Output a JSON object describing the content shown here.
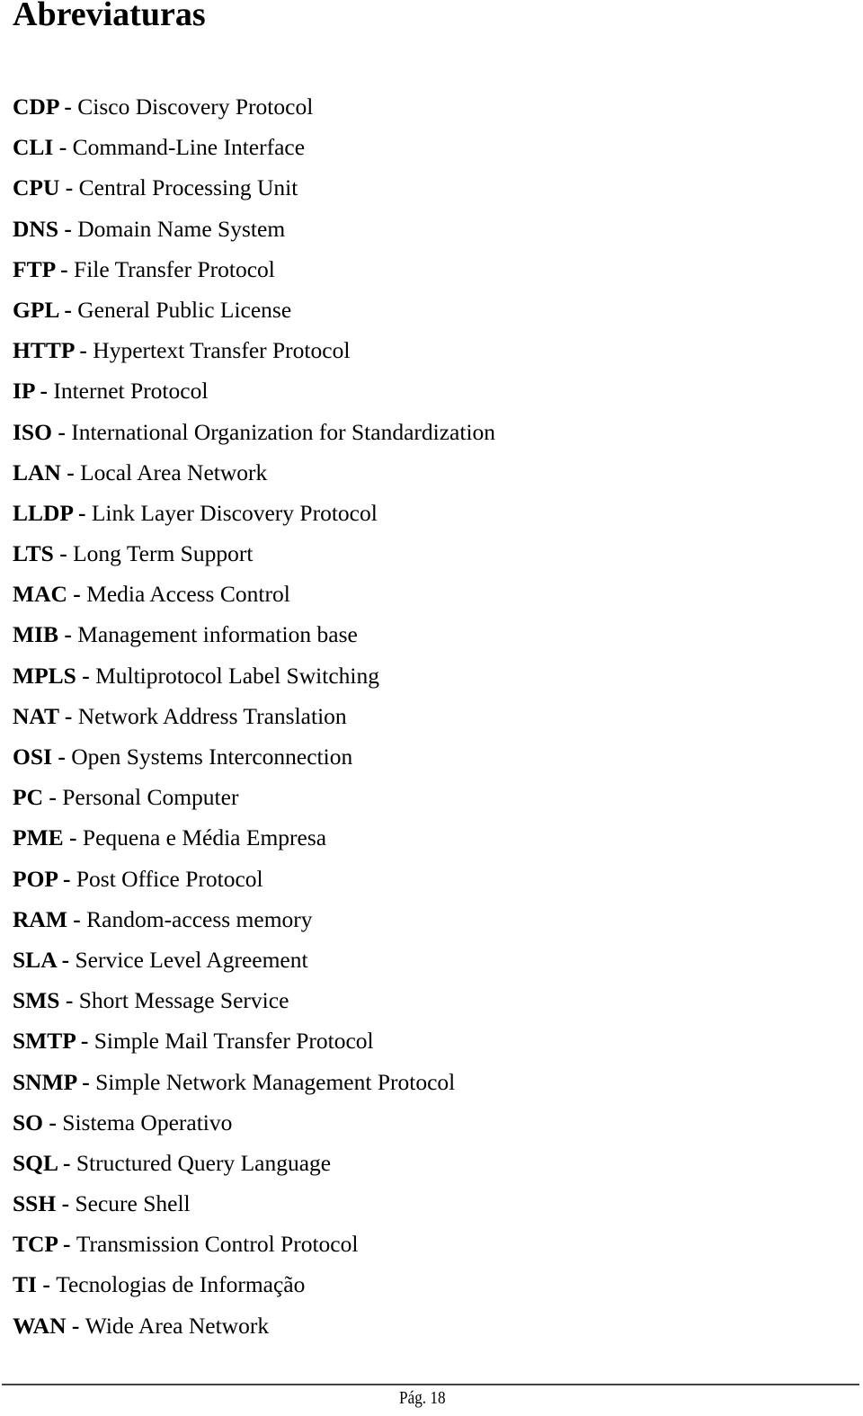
{
  "document": {
    "title": "Abreviaturas",
    "separator": " - ",
    "abbreviations": [
      {
        "code": "CDP",
        "meaning": "Cisco Discovery Protocol"
      },
      {
        "code": "CLI",
        "meaning": "Command-Line Interface"
      },
      {
        "code": "CPU",
        "meaning": "Central Processing Unit"
      },
      {
        "code": "DNS",
        "meaning": "Domain Name System"
      },
      {
        "code": "FTP",
        "meaning": "File Transfer Protocol"
      },
      {
        "code": "GPL",
        "meaning": "General Public License"
      },
      {
        "code": "HTTP",
        "meaning": "Hypertext Transfer Protocol"
      },
      {
        "code": "IP",
        "meaning": "Internet Protocol"
      },
      {
        "code": "ISO",
        "meaning": "International Organization for Standardization"
      },
      {
        "code": "LAN",
        "meaning": "Local Area Network"
      },
      {
        "code": "LLDP",
        "meaning": "Link Layer Discovery Protocol"
      },
      {
        "code": "LTS",
        "meaning": "Long Term Support"
      },
      {
        "code": "MAC",
        "meaning": "Media Access Control"
      },
      {
        "code": "MIB",
        "meaning": "Management information base"
      },
      {
        "code": "MPLS",
        "meaning": "Multiprotocol Label Switching"
      },
      {
        "code": "NAT",
        "meaning": "Network Address Translation"
      },
      {
        "code": "OSI",
        "meaning": "Open Systems Interconnection"
      },
      {
        "code": "PC",
        "meaning": "Personal Computer"
      },
      {
        "code": "PME",
        "meaning": "Pequena e Média Empresa"
      },
      {
        "code": "POP",
        "meaning": "Post Office Protocol"
      },
      {
        "code": "RAM",
        "meaning": "Random-access memory"
      },
      {
        "code": "SLA",
        "meaning": "Service Level Agreement"
      },
      {
        "code": "SMS",
        "meaning": "Short Message Service"
      },
      {
        "code": "SMTP",
        "meaning": "Simple Mail Transfer Protocol"
      },
      {
        "code": "SNMP",
        "meaning": "Simple Network Management Protocol"
      },
      {
        "code": "SO",
        "meaning": "Sistema Operativo"
      },
      {
        "code": "SQL",
        "meaning": "Structured Query Language"
      },
      {
        "code": "SSH",
        "meaning": "Secure Shell"
      },
      {
        "code": "TCP",
        "meaning": "Transmission Control Protocol"
      },
      {
        "code": "TI",
        "meaning": "Tecnologias de Informação"
      },
      {
        "code": "WAN",
        "meaning": "Wide Area Network"
      }
    ]
  },
  "footer": {
    "page_label": "Pág. 18"
  }
}
